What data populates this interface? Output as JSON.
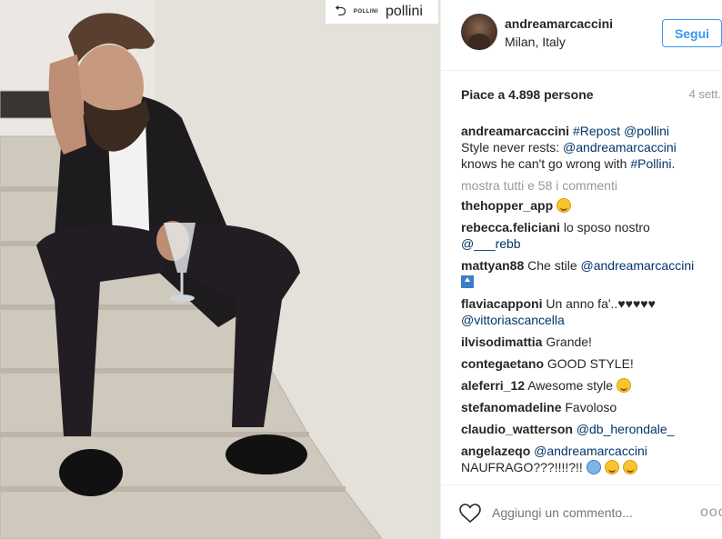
{
  "repost": {
    "icon": "repost-icon",
    "small_label": "POLLINI",
    "brand": "pollini"
  },
  "post": {
    "username": "andreamarcaccini",
    "location": "Milan, Italy",
    "follow_label": "Segui",
    "likes": "Piace a 4.898 persone",
    "time_ago": "4 sett."
  },
  "caption": {
    "user": "andreamarcaccini",
    "line1_tag": "#Repost @pollini",
    "line2_pre": "Style never rests: ",
    "line2_mention": "@andreamarcaccini",
    "line3_pre": "knows he can't go wrong with ",
    "line3_tag": "#Pollini",
    "line3_post": "."
  },
  "show_more": "mostra tutti e 58 i commenti",
  "comments": [
    {
      "user": "thehopper_app",
      "text": "",
      "emoji": "smile"
    },
    {
      "user": "rebecca.feliciani",
      "text": "lo sposo nostro",
      "mention": "@___rebb"
    },
    {
      "user": "mattyan88",
      "text": "Che stile",
      "mention": "@andreamarcaccini"
    },
    {
      "user": "flaviacapponi",
      "text": "Un anno fa'..",
      "hearts": "♥♥♥♥♥",
      "mention": "@vittoriascancella"
    },
    {
      "user": "ilvisodimattia",
      "text": "Grande!"
    },
    {
      "user": "contegaetano",
      "text": "GOOD STYLE!"
    },
    {
      "user": "aleferri_12",
      "text": "Awesome style"
    },
    {
      "user": "stefanomadeline",
      "text": "Favoloso"
    },
    {
      "user": "claudio_watterson",
      "mention": "@db_herondale_"
    },
    {
      "user": "angelazeqo",
      "mention": "@andreamarcaccini",
      "text2": "NAUFRAGO???!!!!?!!"
    }
  ],
  "footer": {
    "placeholder": "Aggiungi un commento...",
    "more": "ooo"
  }
}
